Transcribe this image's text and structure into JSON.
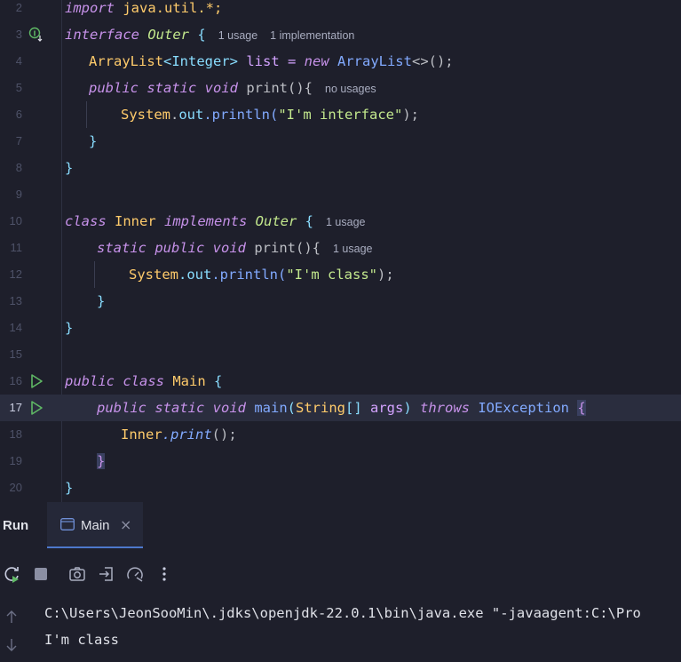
{
  "editor": {
    "lines": [
      {
        "num": "2"
      },
      {
        "num": "3"
      },
      {
        "num": "4"
      },
      {
        "num": "5"
      },
      {
        "num": "6"
      },
      {
        "num": "7"
      },
      {
        "num": "8"
      },
      {
        "num": "9"
      },
      {
        "num": "10"
      },
      {
        "num": "11"
      },
      {
        "num": "12"
      },
      {
        "num": "13"
      },
      {
        "num": "14"
      },
      {
        "num": "15"
      },
      {
        "num": "16"
      },
      {
        "num": "17"
      },
      {
        "num": "18"
      },
      {
        "num": "19"
      },
      {
        "num": "20"
      }
    ],
    "code": {
      "l2_import": "import",
      "l2_rest": " java.util.*;",
      "l3_interface": "interface",
      "l3_name": "Outer",
      "l3_brace": " {",
      "l3_hint1": "1 usage",
      "l3_hint2": "1 implementation",
      "l4_type": "ArrayList",
      "l4_generic": "<Integer>",
      "l4_var": " list = ",
      "l4_new": "new",
      "l4_type2": " ArrayList",
      "l4_rest": "<>();",
      "l5_public": "public",
      "l5_static": " static",
      "l5_void": " void",
      "l5_name": " print(){",
      "l5_hint": "no usages",
      "l6_system": "System",
      "l6_dot": ".",
      "l6_out": "out",
      "l6_println": ".println(",
      "l6_str": "\"I'm interface\"",
      "l6_end": ");",
      "l7_brace": "}",
      "l8_brace": "}",
      "l10_class": "class",
      "l10_name": " Inner",
      "l10_impl": " implements",
      "l10_outer": " Outer",
      "l10_brace": " {",
      "l10_hint": "1 usage",
      "l11_static": "static",
      "l11_public": " public",
      "l11_void": " void",
      "l11_name": " print(){",
      "l11_hint": "1 usage",
      "l12_system": "System",
      "l12_out": ".out",
      "l12_println": ".println(",
      "l12_str": "\"I'm class\"",
      "l12_end": ");",
      "l13_brace": "}",
      "l14_brace": "}",
      "l16_public": "public",
      "l16_class": " class",
      "l16_name": " Main",
      "l16_brace": " {",
      "l17_public": "public",
      "l17_static": " static",
      "l17_void": " void",
      "l17_main": " main",
      "l17_paren": "(",
      "l17_string": "String",
      "l17_arr": "[] ",
      "l17_args": "args",
      "l17_paren2": ")",
      "l17_throws": " throws",
      "l17_ioe": " IOException",
      "l17_brace": "{",
      "l18_inner": "Inner",
      "l18_print": ".print",
      "l18_end": "();",
      "l19_brace": "}",
      "l20_brace": "}"
    }
  },
  "run_panel": {
    "label": "Run",
    "tab_label": "Main",
    "tab_close": "×"
  },
  "console": {
    "line1": "C:\\Users\\JeonSooMin\\.jdks\\openjdk-22.0.1\\bin\\java.exe \"-javaagent:C:\\Pro",
    "line2": "I'm class"
  },
  "colors": {
    "background": "#1e1f2b",
    "keyword": "#c792ea",
    "type": "#ffcb6b",
    "string": "#c3e88d",
    "accent": "#4d78cc"
  }
}
